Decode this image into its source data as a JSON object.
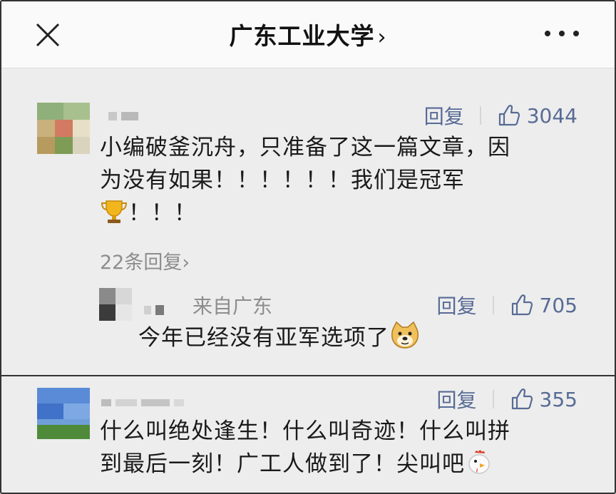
{
  "header": {
    "title": "广东工业大学",
    "title_chevron": "›"
  },
  "comments": [
    {
      "actions": {
        "reply": "回复",
        "likes": "3044"
      },
      "text_lines": [
        "小编破釜沉舟，只准备了这一篇文章，因",
        "为没有如果！！！！！！我们是冠军",
        "！！！"
      ],
      "emoji": "trophy-icon",
      "replies_link": "22条回复›",
      "reply": {
        "from": "来自广东",
        "actions": {
          "reply": "回复",
          "likes": "705"
        },
        "text": "今年已经没有亚军选项了",
        "emoji": "doge-icon"
      }
    },
    {
      "actions": {
        "reply": "回复",
        "likes": "355"
      },
      "text_lines": [
        "什么叫绝处逢生！什么叫奇迹！什么叫拼",
        "到最后一刻！广工人做到了！尖叫吧"
      ],
      "emoji": "chicken-icon"
    }
  ],
  "colors": {
    "link": "#576b95",
    "muted": "#8d8d8d",
    "background": "#ededed"
  }
}
